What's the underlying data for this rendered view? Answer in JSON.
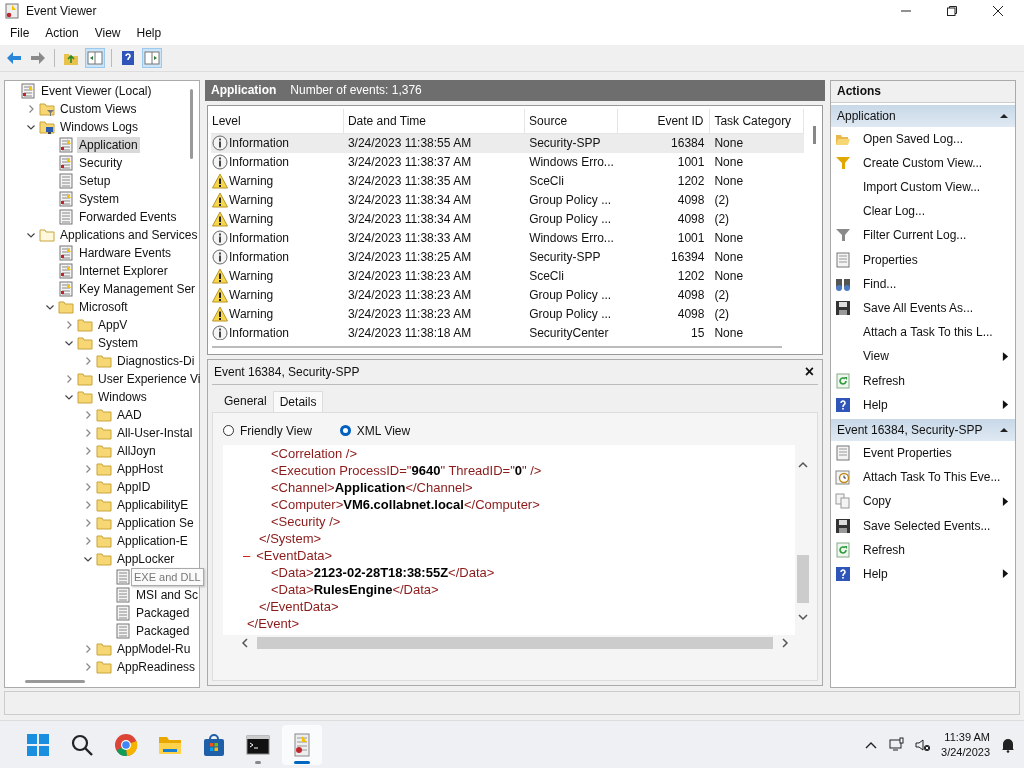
{
  "window": {
    "title": "Event Viewer"
  },
  "menu": [
    "File",
    "Action",
    "View",
    "Help"
  ],
  "toolbar": [
    {
      "kind": "back",
      "pressed": false
    },
    {
      "kind": "forward",
      "pressed": false
    },
    {
      "kind": "up-folder",
      "pressed": false
    },
    {
      "kind": "tree-toggle",
      "pressed": true
    },
    {
      "kind": "help",
      "pressed": false
    },
    {
      "kind": "pane-toggle",
      "pressed": true
    }
  ],
  "tree": [
    {
      "label": "Event Viewer (Local)",
      "kind": "log",
      "selected": false,
      "children": [
        {
          "label": "Custom Views",
          "kind": "filter-folder",
          "expanded": false,
          "selected": false
        },
        {
          "label": "Windows Logs",
          "kind": "computer-folder",
          "expanded": true,
          "selected": false,
          "children": [
            {
              "label": "Application",
              "kind": "log",
              "selected": true
            },
            {
              "label": "Security",
              "kind": "log",
              "selected": false
            },
            {
              "label": "Setup",
              "kind": "plain-log",
              "selected": false
            },
            {
              "label": "System",
              "kind": "log",
              "selected": false
            },
            {
              "label": "Forwarded Events",
              "kind": "plain-log",
              "selected": false
            }
          ]
        },
        {
          "label": "Applications and Services",
          "kind": "service-folder",
          "expanded": true,
          "selected": false,
          "children": [
            {
              "label": "Hardware Events",
              "kind": "log",
              "selected": false
            },
            {
              "label": "Internet Explorer",
              "kind": "log",
              "selected": false
            },
            {
              "label": "Key Management Ser",
              "kind": "log",
              "selected": false
            },
            {
              "label": "Microsoft",
              "kind": "folder",
              "expanded": true,
              "selected": false,
              "children": [
                {
                  "label": "AppV",
                  "kind": "folder",
                  "expanded": false,
                  "selected": false
                },
                {
                  "label": "System",
                  "kind": "folder",
                  "expanded": true,
                  "selected": false,
                  "children": [
                    {
                      "label": "Diagnostics-Di",
                      "kind": "folder",
                      "expanded": false,
                      "selected": false
                    }
                  ]
                },
                {
                  "label": "User Experience Vi",
                  "kind": "folder",
                  "expanded": false,
                  "selected": false
                },
                {
                  "label": "Windows",
                  "kind": "folder",
                  "expanded": true,
                  "selected": false,
                  "children": [
                    {
                      "label": "AAD",
                      "kind": "folder",
                      "expanded": false,
                      "selected": false
                    },
                    {
                      "label": "All-User-Instal",
                      "kind": "folder",
                      "expanded": false,
                      "selected": false
                    },
                    {
                      "label": "AllJoyn",
                      "kind": "folder",
                      "expanded": false,
                      "selected": false
                    },
                    {
                      "label": "AppHost",
                      "kind": "folder",
                      "expanded": false,
                      "selected": false
                    },
                    {
                      "label": "AppID",
                      "kind": "folder",
                      "expanded": false,
                      "selected": false
                    },
                    {
                      "label": "ApplicabilityE",
                      "kind": "folder",
                      "expanded": false,
                      "selected": false
                    },
                    {
                      "label": "Application Se",
                      "kind": "folder",
                      "expanded": false,
                      "selected": false
                    },
                    {
                      "label": "Application-E",
                      "kind": "folder",
                      "expanded": false,
                      "selected": false
                    },
                    {
                      "label": "AppLocker",
                      "kind": "folder",
                      "expanded": true,
                      "selected": false,
                      "children": [
                        {
                          "label": "EXE and DLL",
                          "kind": "plain-log",
                          "selected": false,
                          "hovered": true
                        },
                        {
                          "label": "MSI and Sc",
                          "kind": "plain-log",
                          "selected": false,
                          "hovered": false
                        },
                        {
                          "label": "Packaged",
                          "kind": "plain-log",
                          "selected": false,
                          "hovered": false
                        },
                        {
                          "label": "Packaged",
                          "kind": "plain-log",
                          "selected": false,
                          "hovered": false
                        }
                      ]
                    },
                    {
                      "label": "AppModel-Ru",
                      "kind": "folder",
                      "expanded": false,
                      "selected": false
                    },
                    {
                      "label": "AppReadiness",
                      "kind": "folder",
                      "expanded": false,
                      "selected": false
                    }
                  ]
                }
              ]
            }
          ]
        }
      ]
    }
  ],
  "log_header": {
    "name": "Application",
    "count": "Number of events: 1,376"
  },
  "table": {
    "columns": [
      "Level",
      "Date and Time",
      "Source",
      "Event ID",
      "Task Category"
    ],
    "rows": [
      {
        "kind": "information",
        "level": "Information",
        "date": "3/24/2023 11:38:55 AM",
        "source": "Security-SPP",
        "event_id": "16384",
        "category": "None",
        "selected": true
      },
      {
        "kind": "information",
        "level": "Information",
        "date": "3/24/2023 11:38:37 AM",
        "source": "Windows Erro...",
        "event_id": "1001",
        "category": "None",
        "selected": false
      },
      {
        "kind": "warning",
        "level": "Warning",
        "date": "3/24/2023 11:38:35 AM",
        "source": "SceCli",
        "event_id": "1202",
        "category": "None",
        "selected": false
      },
      {
        "kind": "warning",
        "level": "Warning",
        "date": "3/24/2023 11:38:34 AM",
        "source": "Group Policy ...",
        "event_id": "4098",
        "category": "(2)",
        "selected": false
      },
      {
        "kind": "warning",
        "level": "Warning",
        "date": "3/24/2023 11:38:34 AM",
        "source": "Group Policy ...",
        "event_id": "4098",
        "category": "(2)",
        "selected": false
      },
      {
        "kind": "information",
        "level": "Information",
        "date": "3/24/2023 11:38:33 AM",
        "source": "Windows Erro...",
        "event_id": "1001",
        "category": "None",
        "selected": false
      },
      {
        "kind": "information",
        "level": "Information",
        "date": "3/24/2023 11:38:25 AM",
        "source": "Security-SPP",
        "event_id": "16394",
        "category": "None",
        "selected": false
      },
      {
        "kind": "warning",
        "level": "Warning",
        "date": "3/24/2023 11:38:23 AM",
        "source": "SceCli",
        "event_id": "1202",
        "category": "None",
        "selected": false
      },
      {
        "kind": "warning",
        "level": "Warning",
        "date": "3/24/2023 11:38:23 AM",
        "source": "Group Policy ...",
        "event_id": "4098",
        "category": "(2)",
        "selected": false
      },
      {
        "kind": "warning",
        "level": "Warning",
        "date": "3/24/2023 11:38:23 AM",
        "source": "Group Policy ...",
        "event_id": "4098",
        "category": "(2)",
        "selected": false
      },
      {
        "kind": "information",
        "level": "Information",
        "date": "3/24/2023 11:38:18 AM",
        "source": "SecurityCenter",
        "event_id": "15",
        "category": "None",
        "selected": false
      }
    ]
  },
  "details": {
    "title": "Event 16384, Security-SPP",
    "close": "×",
    "tabs": [
      {
        "label": "General",
        "selected": false
      },
      {
        "label": "Details",
        "selected": true
      }
    ],
    "views": [
      {
        "label": "Friendly View",
        "selected": false
      },
      {
        "label": "XML View",
        "selected": true
      }
    ],
    "xml": {
      "close": "</Event>",
      "children": [
        {
          "close": "</System>",
          "children": [
            {
              "text": "<Correlation />"
            },
            {
              "text": "<Execution ProcessID=\"**9640**\" ThreadID=\"**0**\" />"
            },
            {
              "text": "<Channel>**Application**</Channel>"
            },
            {
              "text": "<Computer>**VM6.collabnet.local**</Computer>"
            },
            {
              "text": "<Security />"
            }
          ]
        },
        {
          "toggle": "–",
          "text": "<EventData>",
          "close": "</EventData>",
          "children": [
            {
              "text": "<Data>**2123-02-28T18:38:55Z**</Data>"
            },
            {
              "text": "<Data>**RulesEngine**</Data>"
            }
          ]
        }
      ]
    }
  },
  "actions": {
    "title": "Actions",
    "sections": [
      {
        "title": "Application",
        "expanded": true,
        "items": [
          {
            "label": "Open Saved Log...",
            "kind": "open-folder",
            "submenu": false
          },
          {
            "label": "Create Custom View...",
            "kind": "funnel",
            "submenu": false
          },
          {
            "label": "Import Custom View...",
            "kind": "none",
            "submenu": false
          },
          {
            "label": "Clear Log...",
            "kind": "none",
            "submenu": false
          },
          {
            "label": "Filter Current Log...",
            "kind": "grey-funnel",
            "submenu": false
          },
          {
            "label": "Properties",
            "kind": "properties",
            "submenu": false
          },
          {
            "label": "Find...",
            "kind": "binoculars",
            "submenu": false
          },
          {
            "label": "Save All Events As...",
            "kind": "disk",
            "submenu": false
          },
          {
            "label": "Attach a Task To this L...",
            "kind": "none",
            "submenu": false
          },
          {
            "label": "View",
            "kind": "none",
            "submenu": true
          },
          {
            "label": "Refresh",
            "kind": "refresh",
            "submenu": false
          },
          {
            "label": "Help",
            "kind": "help",
            "submenu": true
          }
        ]
      },
      {
        "title": "Event 16384, Security-SPP",
        "expanded": true,
        "items": [
          {
            "label": "Event Properties",
            "kind": "properties",
            "submenu": false
          },
          {
            "label": "Attach Task To This Eve...",
            "kind": "clock",
            "submenu": false
          },
          {
            "label": "Copy",
            "kind": "copy",
            "submenu": true
          },
          {
            "label": "Save Selected Events...",
            "kind": "disk",
            "submenu": false
          },
          {
            "label": "Refresh",
            "kind": "refresh",
            "submenu": false
          },
          {
            "label": "Help",
            "kind": "help",
            "submenu": true
          }
        ]
      }
    ]
  },
  "taskbar": {
    "apps": [
      {
        "kind": "start",
        "open": false,
        "focused": false
      },
      {
        "kind": "search",
        "open": false,
        "focused": false
      },
      {
        "kind": "browser",
        "open": false,
        "focused": false
      },
      {
        "kind": "files",
        "open": false,
        "focused": false
      },
      {
        "kind": "store",
        "open": false,
        "focused": false
      },
      {
        "kind": "terminal",
        "open": true,
        "focused": false
      },
      {
        "kind": "event-viewer",
        "open": true,
        "focused": true
      }
    ],
    "time": "11:39 AM",
    "date": "3/24/2023"
  }
}
